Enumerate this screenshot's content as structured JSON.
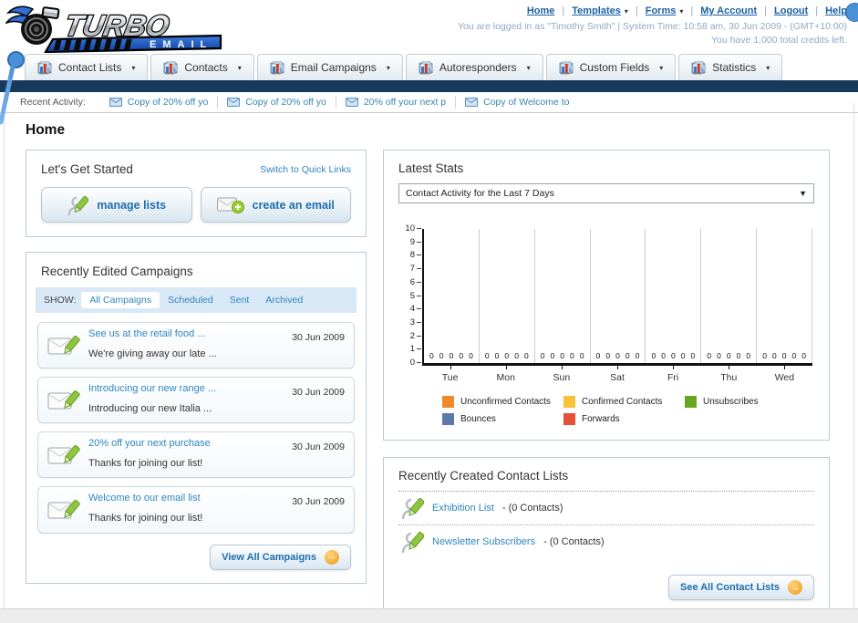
{
  "brand": {
    "title": "TURBO",
    "subtitle": "EMAIL"
  },
  "header": {
    "links": [
      {
        "label": "Home",
        "dropdown": false
      },
      {
        "label": "Templates",
        "dropdown": true
      },
      {
        "label": "Forms",
        "dropdown": true
      },
      {
        "label": "My Account",
        "dropdown": false
      },
      {
        "label": "Logout",
        "dropdown": false
      },
      {
        "label": "Help",
        "dropdown": false
      }
    ],
    "status_line1": "You are logged in as \"Timothy Smith\" | System Time: 10:58 am, 30 Jun 2009 - (GMT+10:00)",
    "status_line2": "You have 1,000 total credits left."
  },
  "nav": {
    "tabs": [
      {
        "label": "Contact Lists",
        "icon": "contact-lists-icon"
      },
      {
        "label": "Contacts",
        "icon": "contacts-icon"
      },
      {
        "label": "Email Campaigns",
        "icon": "email-campaigns-icon"
      },
      {
        "label": "Autoresponders",
        "icon": "autoresponders-icon"
      },
      {
        "label": "Custom Fields",
        "icon": "custom-fields-icon"
      },
      {
        "label": "Statistics",
        "icon": "statistics-icon"
      }
    ]
  },
  "recent_activity": {
    "label": "Recent Activity:",
    "items": [
      "Copy of 20% off yo",
      "Copy of 20% off yo",
      "20% off your next p",
      "Copy of Welcome to"
    ]
  },
  "page": {
    "title": "Home"
  },
  "get_started": {
    "title": "Let's Get Started",
    "switch_link": "Switch to Quick Links",
    "buttons": [
      {
        "label": "manage lists"
      },
      {
        "label": "create an email"
      }
    ]
  },
  "campaigns": {
    "title": "Recently Edited Campaigns",
    "show_label": "SHOW:",
    "tabs": [
      {
        "label": "All Campaigns",
        "active": true
      },
      {
        "label": "Scheduled",
        "active": false
      },
      {
        "label": "Sent",
        "active": false
      },
      {
        "label": "Archived",
        "active": false
      }
    ],
    "items": [
      {
        "title": "See us at the retail food ...",
        "subtitle": "We're giving away our late ...",
        "date": "30 Jun 2009"
      },
      {
        "title": "Introducing our new range ...",
        "subtitle": "Introducing our new Italia ...",
        "date": "30 Jun 2009"
      },
      {
        "title": "20% off your next purchase",
        "subtitle": "Thanks for joining our list!",
        "date": "30 Jun 2009"
      },
      {
        "title": "Welcome to our email list",
        "subtitle": "Thanks for joining our list!",
        "date": "30 Jun 2009"
      }
    ],
    "view_all_label": "View All Campaigns"
  },
  "stats": {
    "title": "Latest Stats",
    "dropdown_value": "Contact Activity for the Last 7 Days"
  },
  "chart_data": {
    "type": "bar",
    "title": "Contact Activity for the Last 7 Days",
    "categories": [
      "Tue",
      "Mon",
      "Sun",
      "Sat",
      "Fri",
      "Thu",
      "Wed"
    ],
    "series": [
      {
        "name": "Unconfirmed Contacts",
        "color": "#f08a2d",
        "values": [
          0,
          0,
          0,
          0,
          0,
          0,
          0
        ]
      },
      {
        "name": "Confirmed Contacts",
        "color": "#f6c33b",
        "values": [
          0,
          0,
          0,
          0,
          0,
          0,
          0
        ]
      },
      {
        "name": "Unsubscribes",
        "color": "#67a61f",
        "values": [
          0,
          0,
          0,
          0,
          0,
          0,
          0
        ]
      },
      {
        "name": "Bounces",
        "color": "#5b79ad",
        "values": [
          0,
          0,
          0,
          0,
          0,
          0,
          0
        ]
      },
      {
        "name": "Forwards",
        "color": "#e8503a",
        "values": [
          0,
          0,
          0,
          0,
          0,
          0,
          0
        ]
      }
    ],
    "ylim": [
      0,
      10
    ],
    "yticks": [
      0,
      1,
      2,
      3,
      4,
      5,
      6,
      7,
      8,
      9,
      10
    ],
    "grid": "vertical",
    "legend_position": "bottom",
    "value_labels_shown": true
  },
  "contact_lists": {
    "title": "Recently Created Contact Lists",
    "items": [
      {
        "name": "Exhibition List",
        "suffix": " - (0 Contacts)"
      },
      {
        "name": "Newsletter Subscribers",
        "suffix": " - (0 Contacts)"
      }
    ],
    "see_all_label": "See All Contact Lists"
  }
}
